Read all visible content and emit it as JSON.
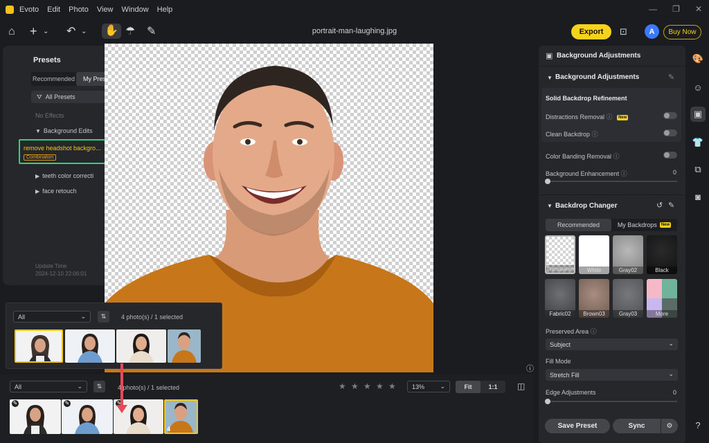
{
  "menu": {
    "app": "Evoto",
    "items": [
      "Edit",
      "Photo",
      "View",
      "Window",
      "Help"
    ]
  },
  "toolbar": {
    "filename": "portrait-man-laughing.jpg",
    "export": "Export",
    "avatar": "A",
    "buy": "Buy Now"
  },
  "presets": {
    "title": "Presets",
    "tabs": [
      "Recommended",
      "My Presets"
    ],
    "filter": "All Presets",
    "no_effects": "No Effects",
    "group": "Background Edits",
    "selected_item": "remove headshot backgro...",
    "selected_badge": "Combination",
    "items": [
      "teeth color correcti",
      "face retouch"
    ],
    "update_label": "Update Time",
    "update_time": "2024-12-10 22:06:01"
  },
  "overlay_strip": {
    "filter": "All",
    "count": "4 photo(s) / 1 selected"
  },
  "bottom": {
    "filter": "All",
    "count": "4 photo(s) / 1 selected",
    "zoom": "13%",
    "fit": "Fit",
    "one_to_one": "1:1",
    "stack_count": "4"
  },
  "right": {
    "header": "Background Adjustments",
    "bg_section": "Background Adjustments",
    "solid_title": "Solid Backdrop Refinement",
    "distractions": "Distractions Removal",
    "new": "New",
    "clean": "Clean Backdrop",
    "banding": "Color Banding Removal",
    "enhancement": "Background Enhancement",
    "enhancement_val": "0",
    "changer": "Backdrop Changer",
    "tab_rec": "Recommended",
    "tab_my": "My Backdrops",
    "backdrops": [
      "Transparent",
      "White",
      "Gray02",
      "Black",
      "Fabric02",
      "Brown03",
      "Gray03",
      "More"
    ],
    "preserved_label": "Preserved Area",
    "preserved_val": "Subject",
    "fill_label": "Fill Mode",
    "fill_val": "Stretch Fill",
    "edge_label": "Edge Adjustments",
    "edge_val": "0",
    "save_preset": "Save Preset",
    "sync": "Sync"
  },
  "colors": {
    "accent_yellow": "#f5d21c",
    "selection_green": "#2fd37a",
    "arrow_red": "#e64a5a",
    "shirt": "#c8761a"
  }
}
